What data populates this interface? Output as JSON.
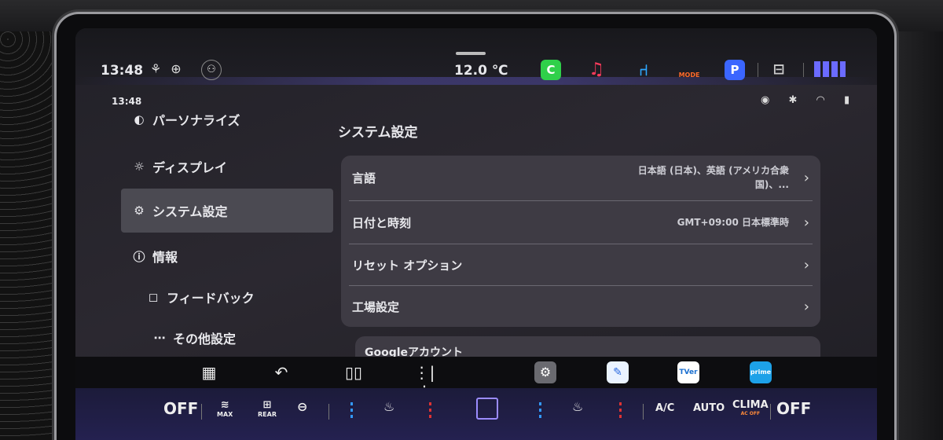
{
  "status_bar": {
    "time": "13:48",
    "temperature": "12.0 ℃",
    "icons": [
      "gesture-icon",
      "globe-icon",
      "user-icon"
    ],
    "apps": [
      {
        "name": "carplay-icon",
        "glyph": "C",
        "color": "#2fd04a"
      },
      {
        "name": "music-icon",
        "glyph": "♫",
        "color": "#ff3b5c"
      },
      {
        "name": "seat-icon",
        "glyph": "⌐",
        "color": "#2ea8ff"
      },
      {
        "name": "drive-mode-icon",
        "glyph": "MODE",
        "color": "#ff6a2a"
      },
      {
        "name": "parking-icon",
        "glyph": "P",
        "color": "#3b66ff"
      },
      {
        "name": "car-icon",
        "glyph": "🚗",
        "color": "#cccccc"
      }
    ]
  },
  "inner_status": {
    "time": "13:48",
    "icons": "◉ ✱ ◠ ▮"
  },
  "sidebar": {
    "items": [
      {
        "label": "パーソナライズ",
        "icon": "◐",
        "icon_name": "palette-icon"
      },
      {
        "label": "ディスプレイ",
        "icon": "☼",
        "icon_name": "brightness-icon"
      },
      {
        "label": "システム設定",
        "icon": "⚙",
        "icon_name": "gear-icon",
        "active": true
      },
      {
        "label": "情報",
        "icon": "ⓘ",
        "icon_name": "info-icon"
      },
      {
        "label": "フィードバック",
        "icon": "◻",
        "icon_name": "feedback-icon"
      },
      {
        "label": "その他設定",
        "icon": "⋯",
        "icon_name": "more-icon"
      }
    ]
  },
  "main": {
    "title": "システム設定",
    "rows": [
      {
        "label": "言語",
        "value": "日本語 (日本)、英語 (アメリカ合衆国)、..."
      },
      {
        "label": "日付と時刻",
        "value": "GMT+09:00 日本標準時"
      },
      {
        "label": "リセット オプション",
        "value": ""
      },
      {
        "label": "工場設定",
        "value": ""
      }
    ],
    "next_card_label": "Googleアカウント"
  },
  "climate": {
    "left_off": "OFF",
    "max": "MAX",
    "rear": "REAR",
    "ac": "A/C",
    "auto": "AUTO",
    "clima": "CLIMA",
    "clima_sub": "AC OFF",
    "right_off": "OFF"
  }
}
